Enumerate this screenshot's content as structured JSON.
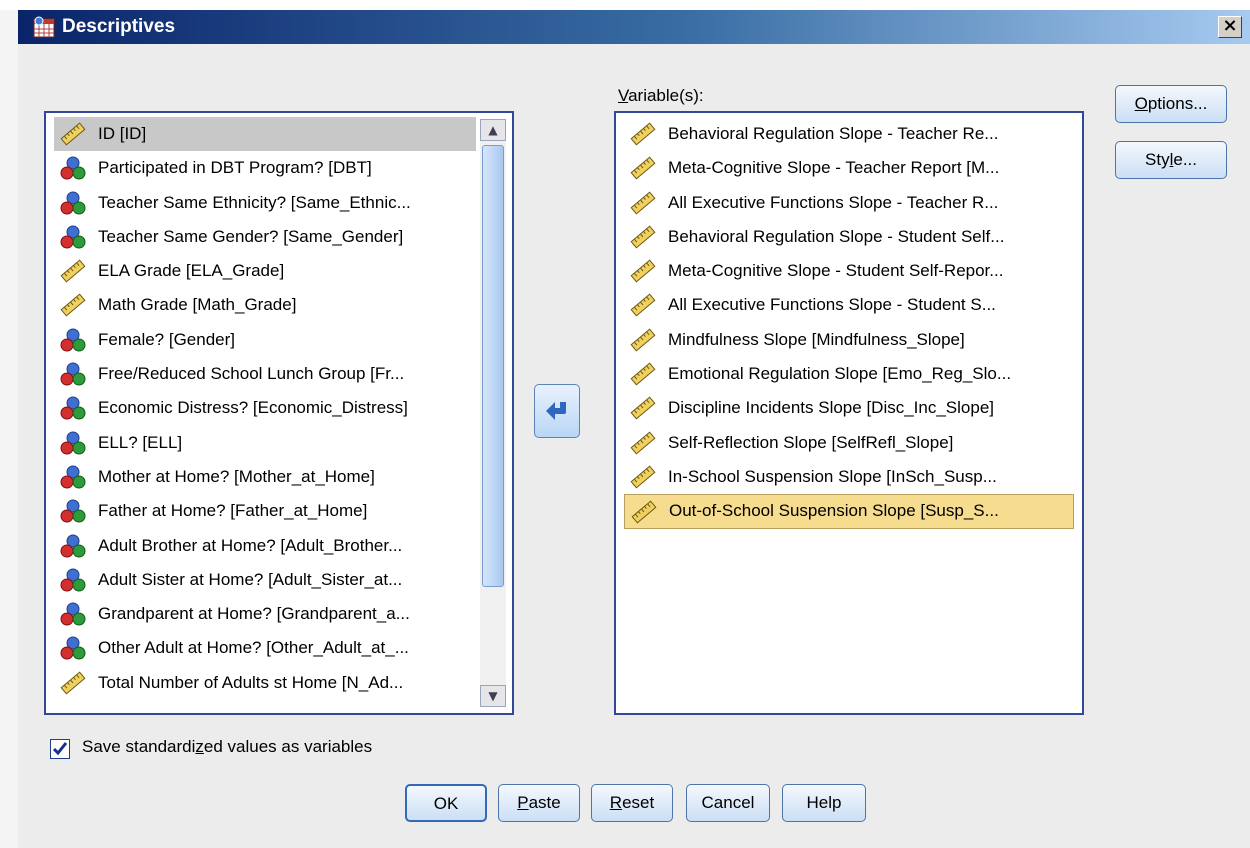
{
  "window": {
    "title": "Descriptives",
    "close_label": "×"
  },
  "source_list": {
    "items": [
      {
        "label": "ID [ID]",
        "icon": "ruler-icon",
        "selected": true
      },
      {
        "label": "Participated in DBT Program? [DBT]",
        "icon": "nominal-icon"
      },
      {
        "label": "Teacher Same Ethnicity? [Same_Ethnic...",
        "icon": "nominal-icon"
      },
      {
        "label": "Teacher Same Gender? [Same_Gender]",
        "icon": "nominal-icon"
      },
      {
        "label": "ELA Grade [ELA_Grade]",
        "icon": "ruler-icon"
      },
      {
        "label": "Math Grade [Math_Grade]",
        "icon": "ruler-icon"
      },
      {
        "label": "Female? [Gender]",
        "icon": "nominal-icon"
      },
      {
        "label": "Free/Reduced School Lunch Group [Fr...",
        "icon": "nominal-icon"
      },
      {
        "label": "Economic Distress? [Economic_Distress]",
        "icon": "nominal-icon"
      },
      {
        "label": "ELL? [ELL]",
        "icon": "nominal-icon"
      },
      {
        "label": "Mother at Home? [Mother_at_Home]",
        "icon": "nominal-icon"
      },
      {
        "label": "Father at Home? [Father_at_Home]",
        "icon": "nominal-icon"
      },
      {
        "label": "Adult Brother at Home? [Adult_Brother...",
        "icon": "nominal-icon"
      },
      {
        "label": "Adult Sister at Home? [Adult_Sister_at...",
        "icon": "nominal-icon"
      },
      {
        "label": "Grandparent at Home? [Grandparent_a...",
        "icon": "nominal-icon"
      },
      {
        "label": "Other Adult at Home? [Other_Adult_at_...",
        "icon": "nominal-icon"
      },
      {
        "label": "Total Number of Adults st Home [N_Ad...",
        "icon": "ruler-icon"
      }
    ],
    "scroll_up": "▲",
    "scroll_down": "▼"
  },
  "target_list": {
    "label_prefix": "V",
    "label_rest": "ariable(s):",
    "items": [
      {
        "label": "Behavioral Regulation Slope - Teacher Re...",
        "icon": "ruler-icon"
      },
      {
        "label": "Meta-Cognitive Slope - Teacher Report [M...",
        "icon": "ruler-icon"
      },
      {
        "label": "All Executive Functions Slope - Teacher R...",
        "icon": "ruler-icon"
      },
      {
        "label": "Behavioral Regulation Slope - Student Self...",
        "icon": "ruler-icon"
      },
      {
        "label": "Meta-Cognitive Slope - Student Self-Repor...",
        "icon": "ruler-icon"
      },
      {
        "label": "All Executive Functions Slope - Student S...",
        "icon": "ruler-icon"
      },
      {
        "label": "Mindfulness Slope [Mindfulness_Slope]",
        "icon": "ruler-icon"
      },
      {
        "label": "Emotional Regulation Slope [Emo_Reg_Slo...",
        "icon": "ruler-icon"
      },
      {
        "label": "Discipline Incidents Slope [Disc_Inc_Slope]",
        "icon": "ruler-icon"
      },
      {
        "label": "Self-Reflection Slope [SelfRefl_Slope]",
        "icon": "ruler-icon"
      },
      {
        "label": "In-School Suspension Slope [InSch_Susp...",
        "icon": "ruler-icon"
      },
      {
        "label": "Out-of-School Suspension Slope [Susp_S...",
        "icon": "ruler-icon",
        "selected": true
      }
    ]
  },
  "side_buttons": {
    "options_u": "O",
    "options_rest": "ptions...",
    "style_pre": "Sty",
    "style_u": "l",
    "style_rest": "e..."
  },
  "checkbox": {
    "checked": true,
    "label_pre": "Save standardi",
    "label_u": "z",
    "label_rest": "ed values as variables"
  },
  "bottom_buttons": {
    "ok": "OK",
    "paste_u": "P",
    "paste_rest": "aste",
    "reset_u": "R",
    "reset_rest": "eset",
    "cancel": "Cancel",
    "help": "Help"
  },
  "colors": {
    "list_border": "#34489a",
    "selected_yellow": "#f6dc8f",
    "selected_gray": "#c8c8c8",
    "title_gradient_start": "#0a246a"
  }
}
